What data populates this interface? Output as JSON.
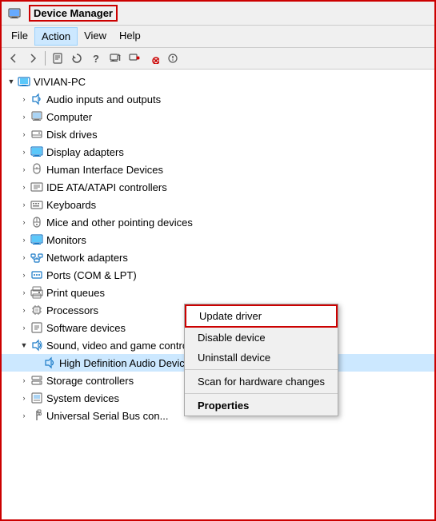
{
  "window": {
    "title": "Device Manager"
  },
  "menubar": {
    "items": [
      "File",
      "Action",
      "View",
      "Help"
    ]
  },
  "toolbar": {
    "buttons": [
      "◀",
      "▶",
      "⊞",
      "⊟",
      "?",
      "⊡",
      "⊟",
      "🖥",
      "✕",
      "⊕"
    ]
  },
  "tree": {
    "root": {
      "label": "VIVIAN-PC",
      "expanded": true
    },
    "items": [
      {
        "id": "audio",
        "label": "Audio inputs and outputs",
        "indent": 1,
        "icon": "audio",
        "expanded": false
      },
      {
        "id": "computer",
        "label": "Computer",
        "indent": 1,
        "icon": "computer",
        "expanded": false
      },
      {
        "id": "disk",
        "label": "Disk drives",
        "indent": 1,
        "icon": "disk",
        "expanded": false
      },
      {
        "id": "display",
        "label": "Display adapters",
        "indent": 1,
        "icon": "display",
        "expanded": false
      },
      {
        "id": "hid",
        "label": "Human Interface Devices",
        "indent": 1,
        "icon": "hid",
        "expanded": false
      },
      {
        "id": "ide",
        "label": "IDE ATA/ATAPI controllers",
        "indent": 1,
        "icon": "ide",
        "expanded": false
      },
      {
        "id": "keyboards",
        "label": "Keyboards",
        "indent": 1,
        "icon": "keyboard",
        "expanded": false
      },
      {
        "id": "mice",
        "label": "Mice and other pointing devices",
        "indent": 1,
        "icon": "mouse",
        "expanded": false
      },
      {
        "id": "monitors",
        "label": "Monitors",
        "indent": 1,
        "icon": "monitor",
        "expanded": false
      },
      {
        "id": "network",
        "label": "Network adapters",
        "indent": 1,
        "icon": "network",
        "expanded": false
      },
      {
        "id": "ports",
        "label": "Ports (COM & LPT)",
        "indent": 1,
        "icon": "ports",
        "expanded": false
      },
      {
        "id": "print",
        "label": "Print queues",
        "indent": 1,
        "icon": "print",
        "expanded": false
      },
      {
        "id": "processors",
        "label": "Processors",
        "indent": 1,
        "icon": "processor",
        "expanded": false
      },
      {
        "id": "software",
        "label": "Software devices",
        "indent": 1,
        "icon": "software",
        "expanded": false
      },
      {
        "id": "sound",
        "label": "Sound, video and game controllers",
        "indent": 1,
        "icon": "sound",
        "expanded": true
      },
      {
        "id": "hda",
        "label": "High Definition Audio Device",
        "indent": 2,
        "icon": "audio-device",
        "expanded": false,
        "selected": true
      },
      {
        "id": "storage",
        "label": "Storage controllers",
        "indent": 1,
        "icon": "storage",
        "expanded": false
      },
      {
        "id": "system",
        "label": "System devices",
        "indent": 1,
        "icon": "system",
        "expanded": false
      },
      {
        "id": "usb",
        "label": "Universal Serial Bus con...",
        "indent": 1,
        "icon": "usb",
        "expanded": false
      }
    ]
  },
  "context_menu": {
    "items": [
      {
        "id": "update",
        "label": "Update driver",
        "type": "first"
      },
      {
        "id": "disable",
        "label": "Disable device",
        "type": "normal"
      },
      {
        "id": "uninstall",
        "label": "Uninstall device",
        "type": "normal"
      },
      {
        "id": "sep1",
        "type": "separator"
      },
      {
        "id": "scan",
        "label": "Scan for hardware changes",
        "type": "normal"
      },
      {
        "id": "sep2",
        "type": "separator"
      },
      {
        "id": "props",
        "label": "Properties",
        "type": "bold"
      }
    ]
  }
}
